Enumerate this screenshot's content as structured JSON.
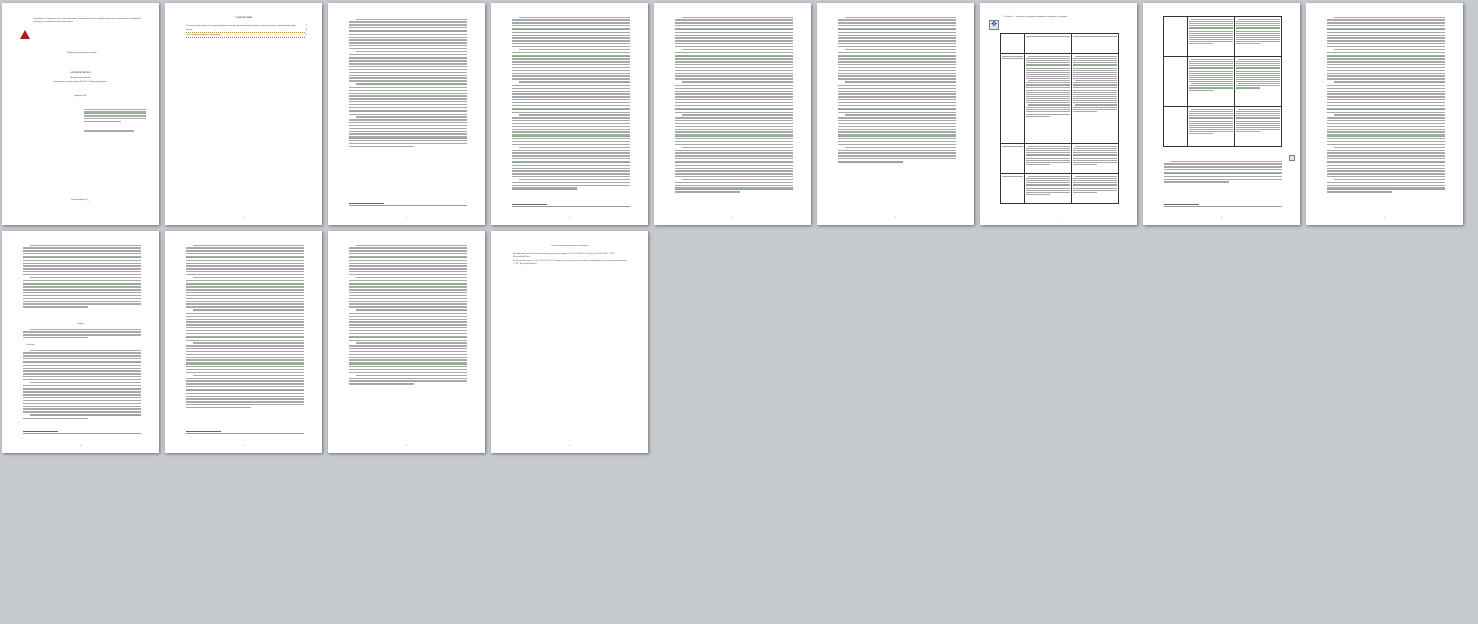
{
  "document": {
    "university_header": "Федеральное государственное образовательное учреждение высшего профессионального образования «Сибирский университет потребительской кооперации»",
    "department": "Кафедра гражданского права",
    "work_type": "ЗАОЧНОЕ ПРАВО",
    "subject": "Контрольная работа",
    "topic": "направление подготовки 40.03.01 «Юриспруденция»",
    "variant": "Вариант №1",
    "city_year": "Новосибирск 20__",
    "toc_title": "СОДЕРЖАНИЕ",
    "toc": [
      {
        "label": "Теоретический вопрос: Основания (юридические факты) возникновения прав и свобод человека в гражданском праве",
        "page": "3"
      },
      {
        "label": "Задача",
        "page": "10"
      },
      {
        "label": "Список использованных источников",
        "page": "13"
      }
    ],
    "table_caption": "Таблица 1 - Сравнение гражданско-правовых и трудовых договоров",
    "solution_label": "Решение",
    "task_label": "Задача",
    "sources_title": "Список использованных источников",
    "sources": [
      "Гражданский кодекс Российской Федерации (часть первая) от 30.11.1994 N 51-ФЗ (ред. от 09.03.2021) // СПС КонсультантПлюс.",
      "Федеральный закон от 14.07.2022 N 255-ФЗ «О контроле за деятельностью лиц, находящихся под иностранным влиянием» // СПС КонсультантПлюс."
    ]
  },
  "pages": [
    {
      "id": "p1",
      "num": "1"
    },
    {
      "id": "p2",
      "num": "2"
    },
    {
      "id": "p3",
      "num": "3"
    },
    {
      "id": "p4",
      "num": "4"
    },
    {
      "id": "p5",
      "num": "5"
    },
    {
      "id": "p6",
      "num": "6"
    },
    {
      "id": "p7",
      "num": "7"
    },
    {
      "id": "p8",
      "num": "8"
    },
    {
      "id": "p9",
      "num": "9"
    },
    {
      "id": "p10",
      "num": "10"
    },
    {
      "id": "p11",
      "num": "11"
    },
    {
      "id": "p12",
      "num": "12"
    },
    {
      "id": "p13",
      "num": "13"
    }
  ],
  "colors": {
    "workspace": "#c6c9ce",
    "page": "#ffffff",
    "logo": "#b3161d",
    "link_underline": "#2e9e2e"
  }
}
